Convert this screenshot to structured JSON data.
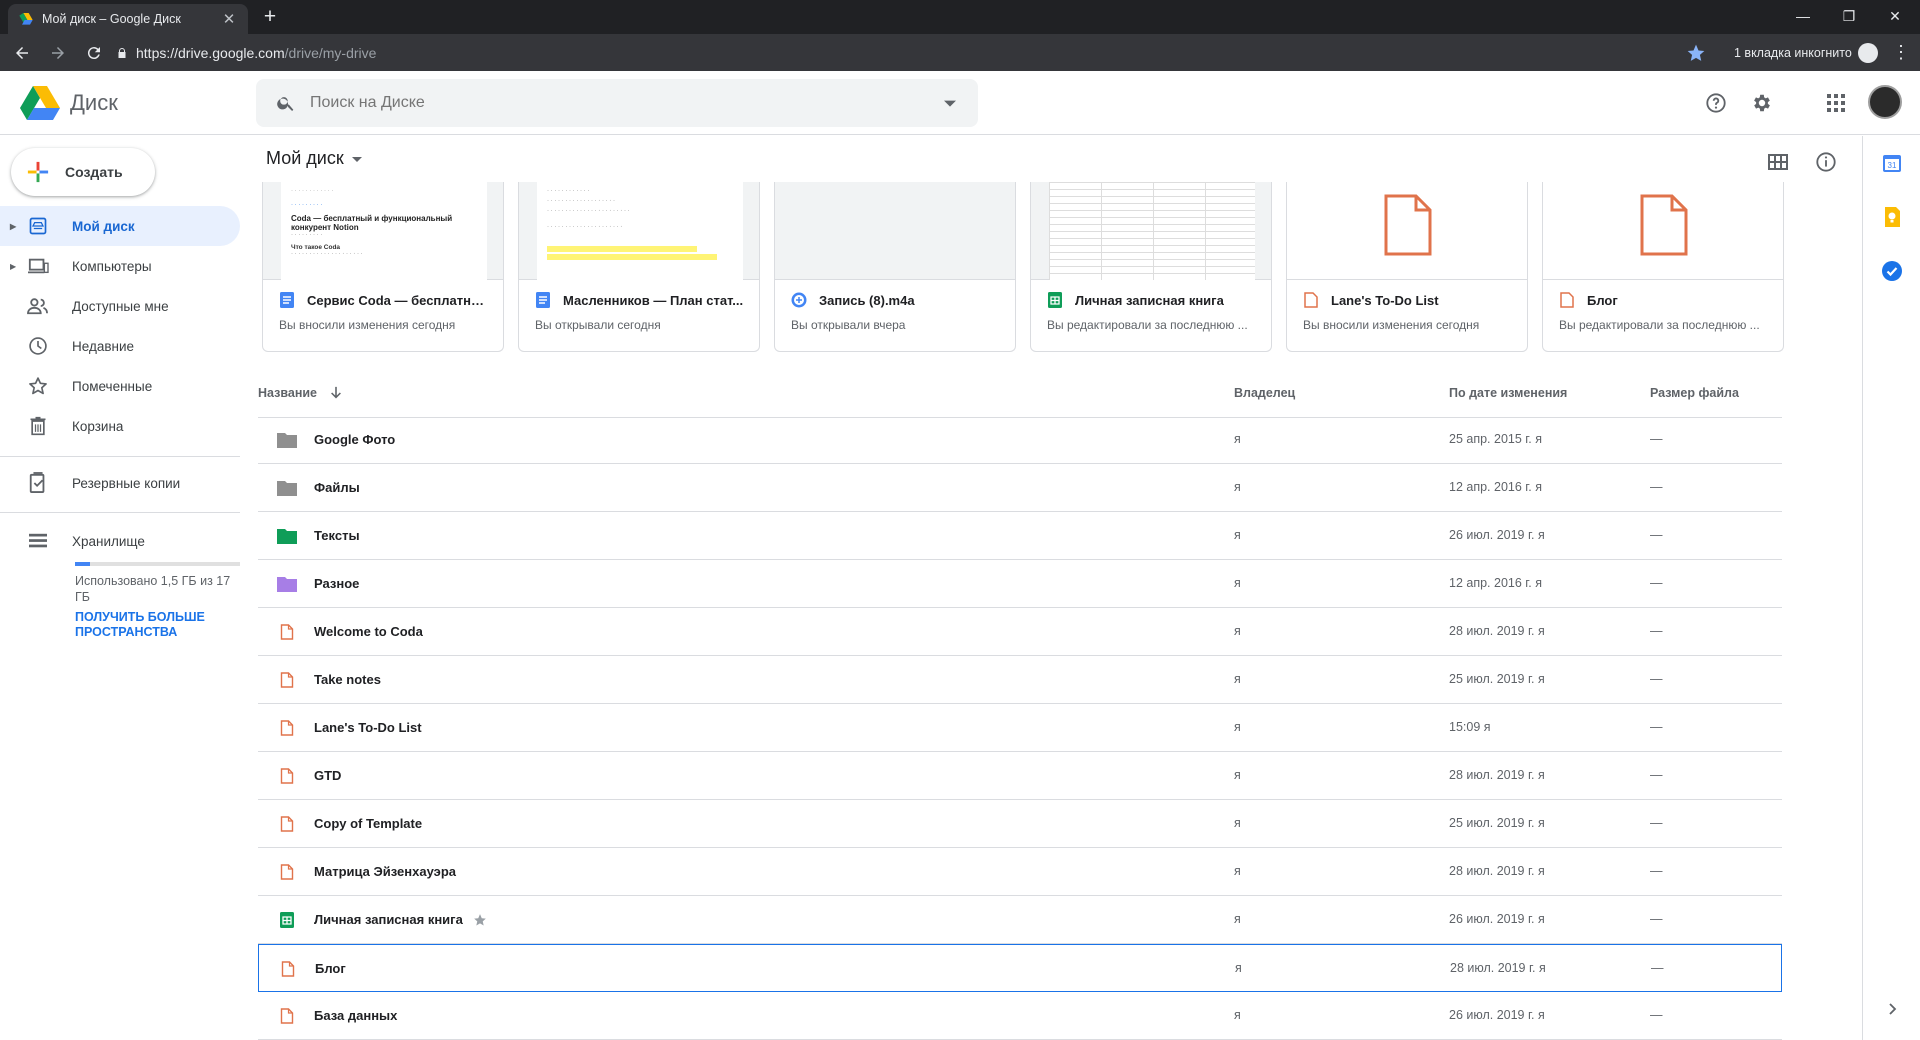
{
  "browser": {
    "tab_title": "Мой диск – Google Диск",
    "url_host": "https://drive.google.com",
    "url_path": "/drive/my-drive",
    "incognito_label": "1 вкладка инкогнито"
  },
  "header": {
    "app_name": "Диск",
    "search_placeholder": "Поиск на Диске"
  },
  "sidebar": {
    "create_label": "Создать",
    "items": [
      {
        "label": "Мой диск",
        "icon": "my-drive-icon",
        "active": true
      },
      {
        "label": "Компьютеры",
        "icon": "computers-icon"
      },
      {
        "label": "Доступные мне",
        "icon": "shared-icon"
      },
      {
        "label": "Недавние",
        "icon": "clock-icon"
      },
      {
        "label": "Помеченные",
        "icon": "star-icon"
      },
      {
        "label": "Корзина",
        "icon": "trash-icon"
      },
      {
        "label": "Резервные копии",
        "icon": "backup-icon"
      },
      {
        "label": "Хранилище",
        "icon": "storage-icon"
      }
    ],
    "storage_used_text": "Использовано 1,5 ГБ из 17 ГБ",
    "storage_used_fraction": 0.088,
    "get_more_label": "ПОЛУЧИТЬ БОЛЬШЕ ПРОСТРАНСТВА"
  },
  "main": {
    "breadcrumb": "Мой диск",
    "quick_access": [
      {
        "title": "Сервис Coda — бесплатный...",
        "subtitle": "Вы вносили изменения сегодня",
        "type": "doc"
      },
      {
        "title": "Масленников — План стат...",
        "subtitle": "Вы открывали сегодня",
        "type": "doc"
      },
      {
        "title": "Запись (8).m4a",
        "subtitle": "Вы открывали вчера",
        "type": "audio"
      },
      {
        "title": "Личная записная книга",
        "subtitle": "Вы редактировали за последнюю ...",
        "type": "sheet"
      },
      {
        "title": "Lane's To-Do List",
        "subtitle": "Вы вносили изменения сегодня",
        "type": "file"
      },
      {
        "title": "Блог",
        "subtitle": "Вы редактировали за последнюю ...",
        "type": "file"
      }
    ],
    "preview_text": {
      "doc1_heading": "Coda — бесплатный и функциональный конкурент Notion",
      "doc1_sub": "Что такое Coda"
    },
    "columns": {
      "name": "Название",
      "owner": "Владелец",
      "modified": "По дате изменения",
      "size": "Размер файла"
    },
    "files": [
      {
        "name": "Google Фото",
        "type": "folder-gray",
        "owner": "я",
        "date": "25 апр. 2015 г. я",
        "size": "—"
      },
      {
        "name": "Файлы",
        "type": "folder-gray",
        "owner": "я",
        "date": "12 апр. 2016 г. я",
        "size": "—"
      },
      {
        "name": "Тексты",
        "type": "folder-green",
        "owner": "я",
        "date": "26 июл. 2019 г. я",
        "size": "—"
      },
      {
        "name": "Разное",
        "type": "folder-purple",
        "owner": "я",
        "date": "12 апр. 2016 г. я",
        "size": "—"
      },
      {
        "name": "Welcome to Coda",
        "type": "file",
        "owner": "я",
        "date": "28 июл. 2019 г. я",
        "size": "—"
      },
      {
        "name": "Take notes",
        "type": "file",
        "owner": "я",
        "date": "25 июл. 2019 г. я",
        "size": "—"
      },
      {
        "name": "Lane's To-Do List",
        "type": "file",
        "owner": "я",
        "date": "15:09 я",
        "size": "—"
      },
      {
        "name": "GTD",
        "type": "file",
        "owner": "я",
        "date": "28 июл. 2019 г. я",
        "size": "—"
      },
      {
        "name": "Copy of Template",
        "type": "file",
        "owner": "я",
        "date": "25 июл. 2019 г. я",
        "size": "—"
      },
      {
        "name": "Матрица Эйзенхауэра",
        "type": "file",
        "owner": "я",
        "date": "28 июл. 2019 г. я",
        "size": "—"
      },
      {
        "name": "Личная записная книга",
        "type": "sheet",
        "owner": "я",
        "date": "26 июл. 2019 г. я",
        "size": "—",
        "starred": true
      },
      {
        "name": "Блог",
        "type": "file",
        "owner": "я",
        "date": "28 июл. 2019 г. я",
        "size": "—",
        "selected": true
      },
      {
        "name": "База данных",
        "type": "file",
        "owner": "я",
        "date": "26 июл. 2019 г. я",
        "size": "—"
      }
    ]
  },
  "colors": {
    "accent_blue": "#1a73e8",
    "folder_gray": "#8f8f8f",
    "folder_green": "#0f9d58",
    "folder_purple": "#a77ee6",
    "file_orange": "#e0734b",
    "sheet_green": "#0f9d58",
    "doc_blue": "#4285f4"
  }
}
